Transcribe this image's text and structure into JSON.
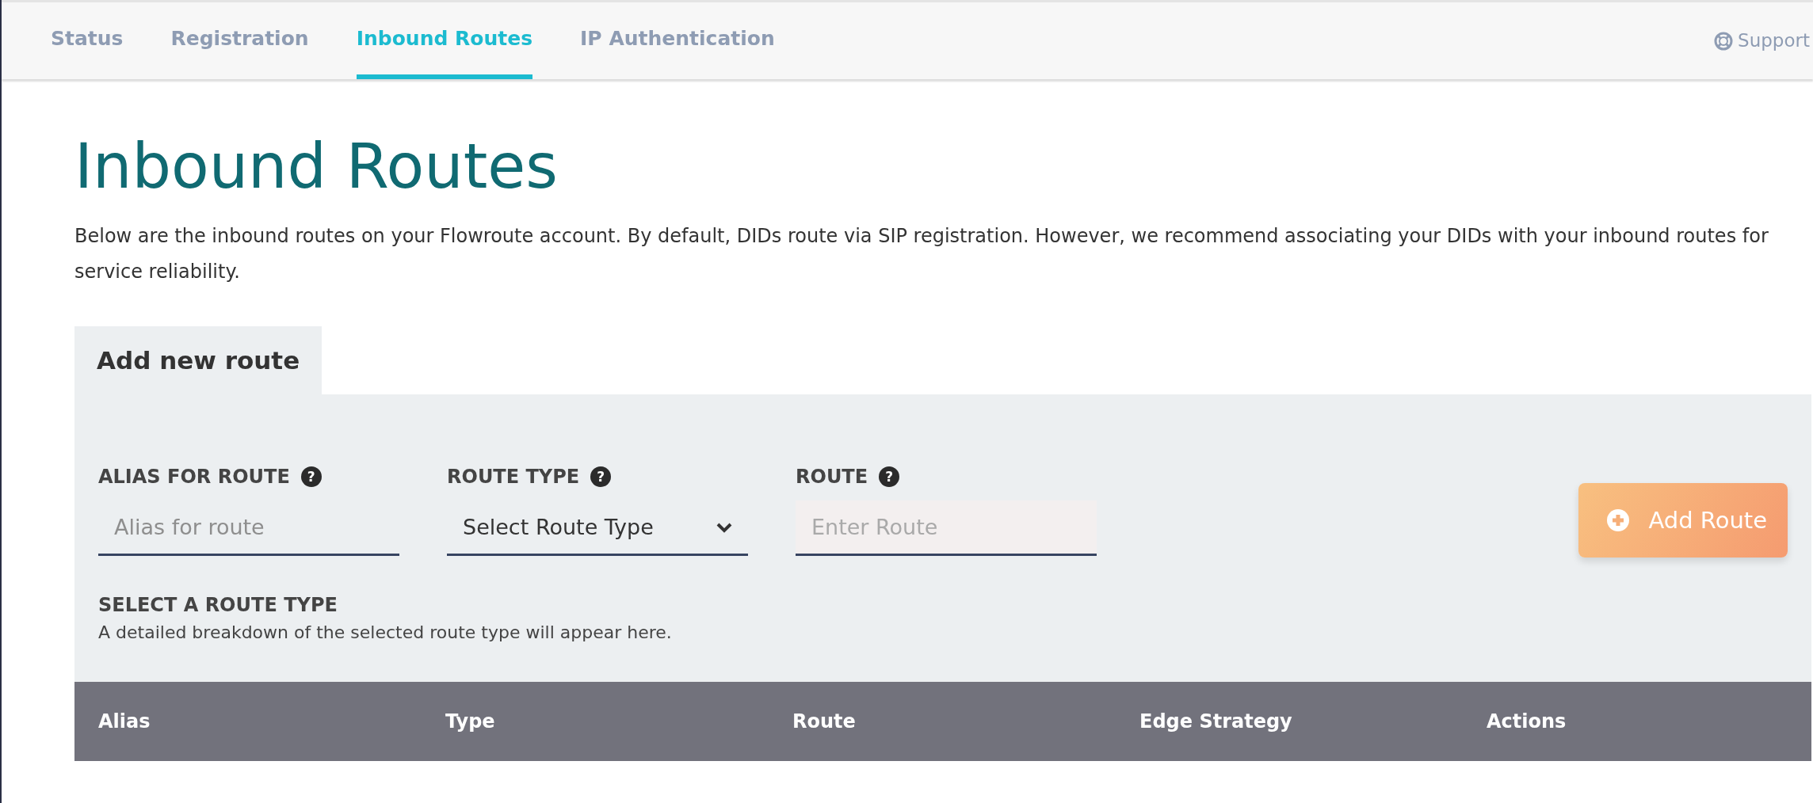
{
  "nav": {
    "tabs": [
      {
        "label": "Status",
        "selected": false
      },
      {
        "label": "Registration",
        "selected": false
      },
      {
        "label": "Inbound Routes",
        "selected": true
      },
      {
        "label": "IP Authentication",
        "selected": false
      }
    ],
    "support": "Support"
  },
  "page": {
    "title": "Inbound Routes",
    "description": "Below are the inbound routes on your Flowroute account. By default, DIDs route via SIP registration. However, we recommend associating your DIDs with your inbound routes for service reliability."
  },
  "add_route": {
    "tab": "Add new route",
    "fields": [
      {
        "kind": "text",
        "label": "ALIAS FOR ROUTE",
        "help": "?",
        "placeholder": "Alias for route",
        "disabled": false
      },
      {
        "kind": "select",
        "label": "ROUTE TYPE",
        "help": "?",
        "value": "Select Route Type",
        "disabled": false
      },
      {
        "kind": "text",
        "label": "ROUTE",
        "help": "?",
        "placeholder": "Enter Route",
        "disabled": true
      }
    ],
    "button": "Add Route",
    "info_title": "SELECT A ROUTE TYPE",
    "info_text": "A detailed breakdown of the selected route type will appear here."
  },
  "table": {
    "columns": [
      "Alias",
      "Type",
      "Route",
      "Edge Strategy",
      "Actions"
    ]
  }
}
